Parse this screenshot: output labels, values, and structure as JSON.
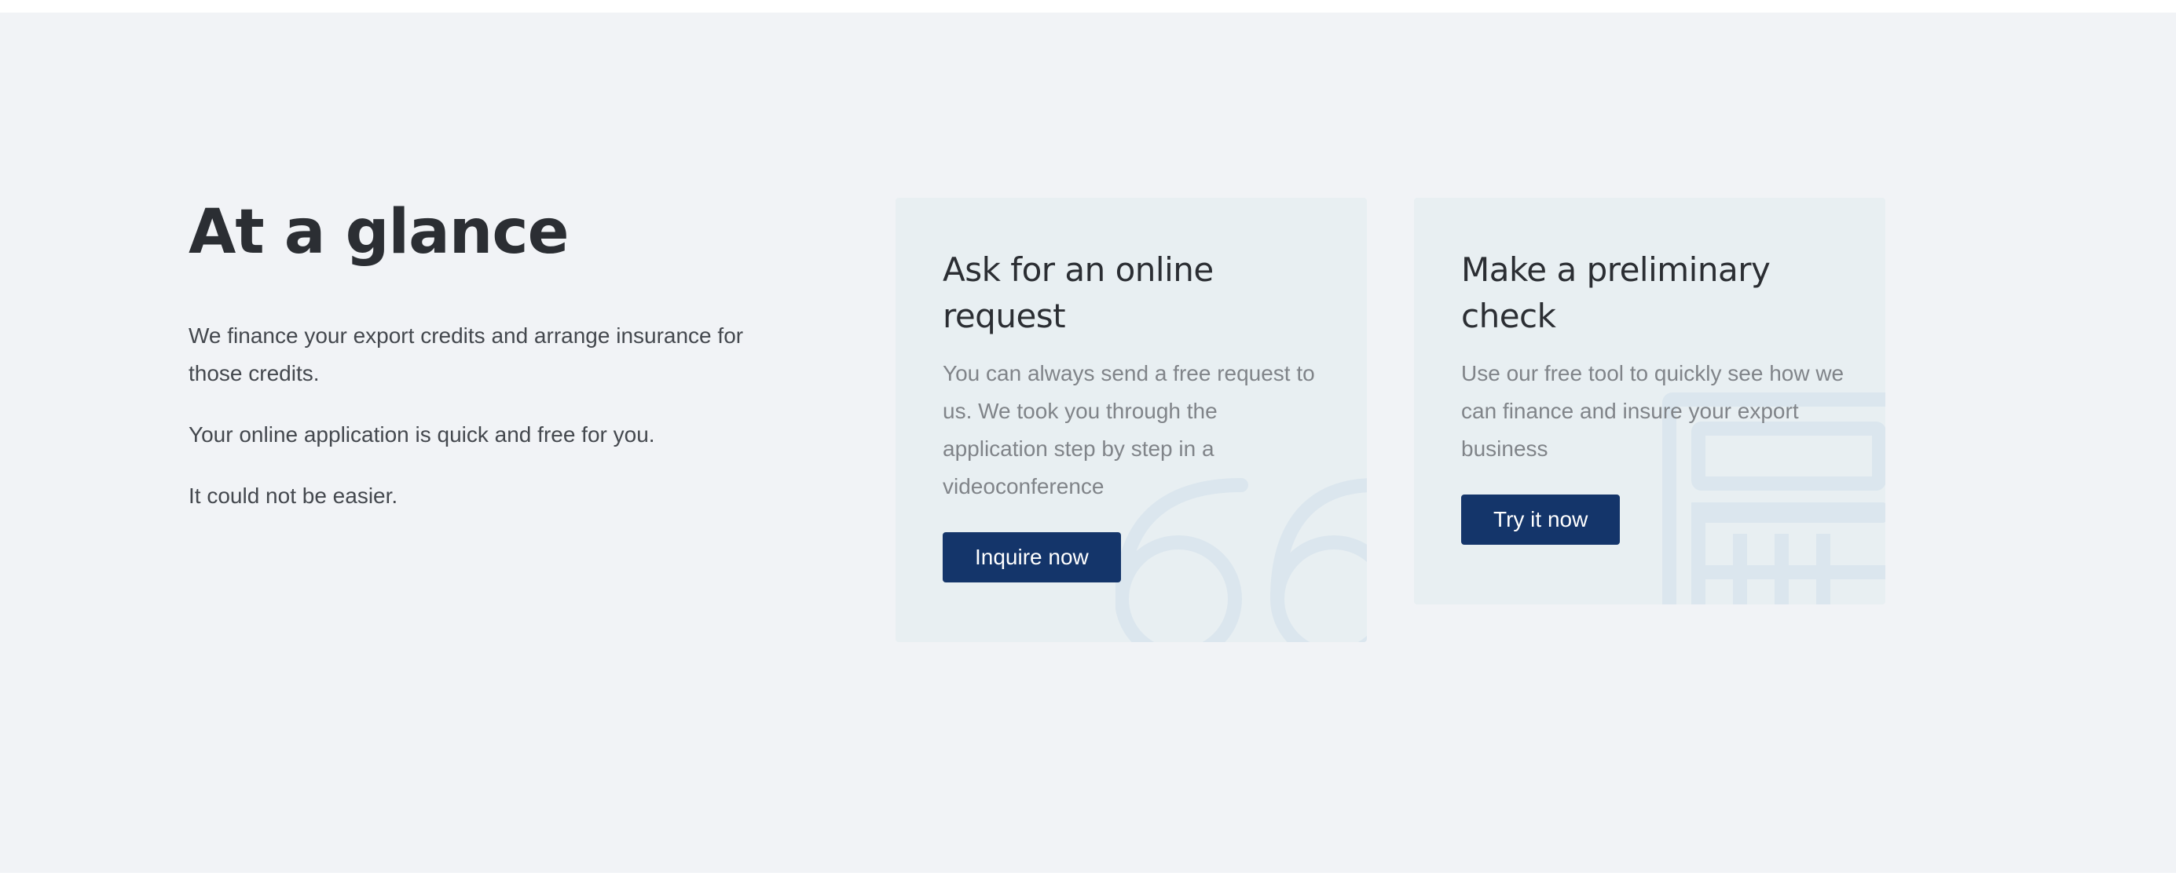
{
  "intro": {
    "title": "At a glance",
    "paragraphs": [
      "We finance your export credits and arrange insurance for those credits.",
      "Your online application is quick and free for you.",
      "It could not be easier."
    ]
  },
  "cards": [
    {
      "title": "Ask for an online request",
      "text": "You can always send a free request to us. We took you through the application step by step in a videoconference",
      "button": "Inquire now",
      "icon": "quote-icon"
    },
    {
      "title": "Make a preliminary check",
      "text": "Use our free tool to quickly see how we can finance and insure your export business",
      "button": "Try it now",
      "icon": "calculator-icon"
    }
  ],
  "colors": {
    "background": "#f1f3f6",
    "card": "#e8eff2",
    "button": "#14356a",
    "heading": "#2b2e33",
    "muted_text": "#808489"
  }
}
